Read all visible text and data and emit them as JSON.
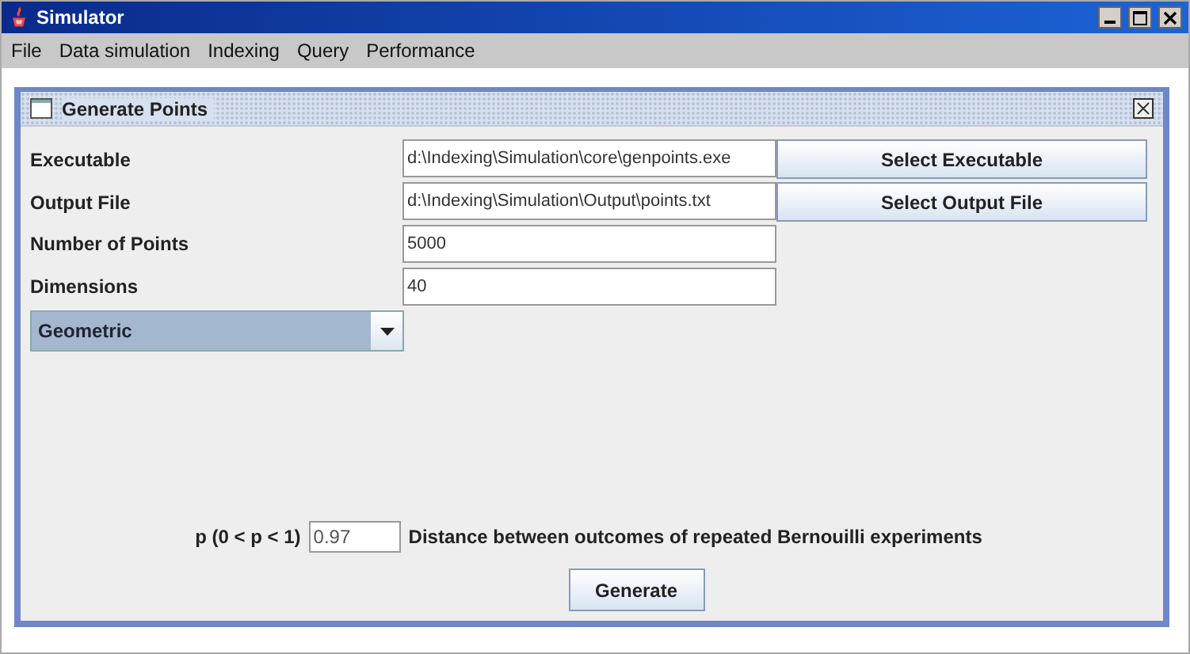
{
  "window": {
    "title": "Simulator"
  },
  "menu": [
    "File",
    "Data simulation",
    "Indexing",
    "Query",
    "Performance"
  ],
  "frame": {
    "title": "Generate Points",
    "rows": [
      {
        "label": "Executable",
        "value": "d:\\Indexing\\Simulation\\core\\genpoints.exe",
        "button": "Select Executable"
      },
      {
        "label": "Output File",
        "value": "d:\\Indexing\\Simulation\\Output\\points.txt",
        "button": "Select Output File"
      },
      {
        "label": "Number of Points",
        "value": "5000"
      },
      {
        "label": "Dimensions",
        "value": "40"
      }
    ],
    "distribution": "Geometric",
    "parameter": {
      "label": "p (0 < p < 1)",
      "value": "0.97",
      "description": "Distance between outcomes of repeated Bernouilli experiments"
    },
    "action": "Generate"
  }
}
